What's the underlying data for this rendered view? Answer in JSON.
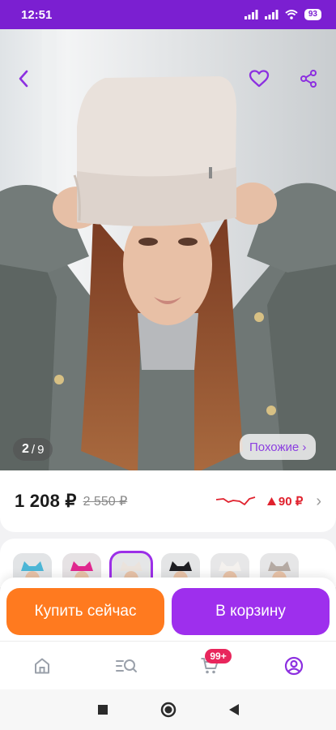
{
  "status_bar": {
    "time": "12:51",
    "battery": "93"
  },
  "gallery": {
    "current": "2",
    "separator": "/",
    "total": "9",
    "similar_label": "Похожие ›"
  },
  "price": {
    "current": "1 208 ₽",
    "old": "2 550 ₽",
    "change": "90 ₽"
  },
  "variants": [
    {
      "name": "blue"
    },
    {
      "name": "pink"
    },
    {
      "name": "beige",
      "selected": true
    },
    {
      "name": "black"
    },
    {
      "name": "white"
    },
    {
      "name": "grey"
    }
  ],
  "actions": {
    "buy_now": "Купить сейчас",
    "add_to_cart": "В корзину"
  },
  "nav": {
    "cart_badge": "99+"
  },
  "colors": {
    "brand": "#7b1fd1",
    "buy": "#ff7a1f",
    "cart": "#9e2fed",
    "price_up": "#e0222e"
  }
}
